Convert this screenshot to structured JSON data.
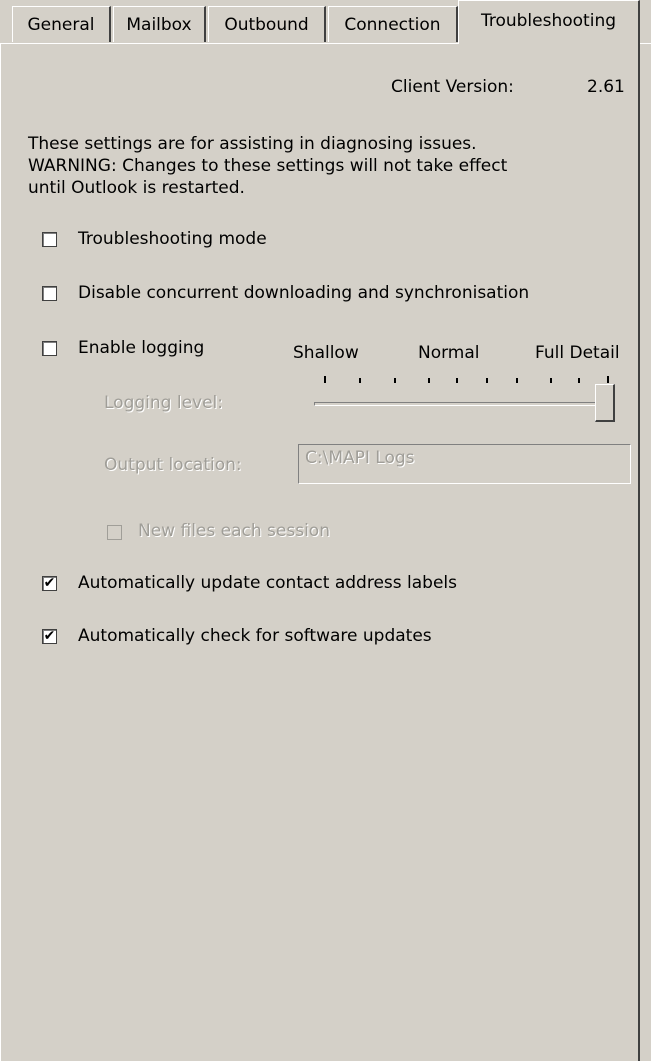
{
  "tabs": [
    {
      "label": "General",
      "active": false
    },
    {
      "label": "Mailbox",
      "active": false
    },
    {
      "label": "Outbound",
      "active": false
    },
    {
      "label": "Connection",
      "active": false
    },
    {
      "label": "Troubleshooting",
      "active": true
    }
  ],
  "client_version": {
    "label": "Client Version:",
    "value": "2.61"
  },
  "description": {
    "line1": "These settings are for assisting in diagnosing issues.",
    "line2": "WARNING: Changes to these settings will not take effect",
    "line3": "until Outlook is restarted."
  },
  "options": {
    "troubleshooting_mode": {
      "label": "Troubleshooting mode",
      "checked": false
    },
    "disable_concurrent": {
      "label": "Disable concurrent downloading and synchronisation",
      "checked": false
    },
    "enable_logging": {
      "label": "Enable logging",
      "checked": false
    },
    "auto_update_labels": {
      "label": "Automatically update contact address labels",
      "checked": true
    },
    "auto_check_updates": {
      "label": "Automatically check for software updates",
      "checked": true
    }
  },
  "logging": {
    "scale_labels": {
      "shallow": "Shallow",
      "normal": "Normal",
      "full": "Full Detail"
    },
    "level_label": "Logging level:",
    "level_fraction": 1.0,
    "output_label": "Output location:",
    "output_value": "C:\\MAPI Logs",
    "new_files": {
      "label": "New files each session",
      "checked": false
    }
  },
  "colors": {
    "background": "#d4d0c8",
    "disabled_text": "#a09e98"
  }
}
